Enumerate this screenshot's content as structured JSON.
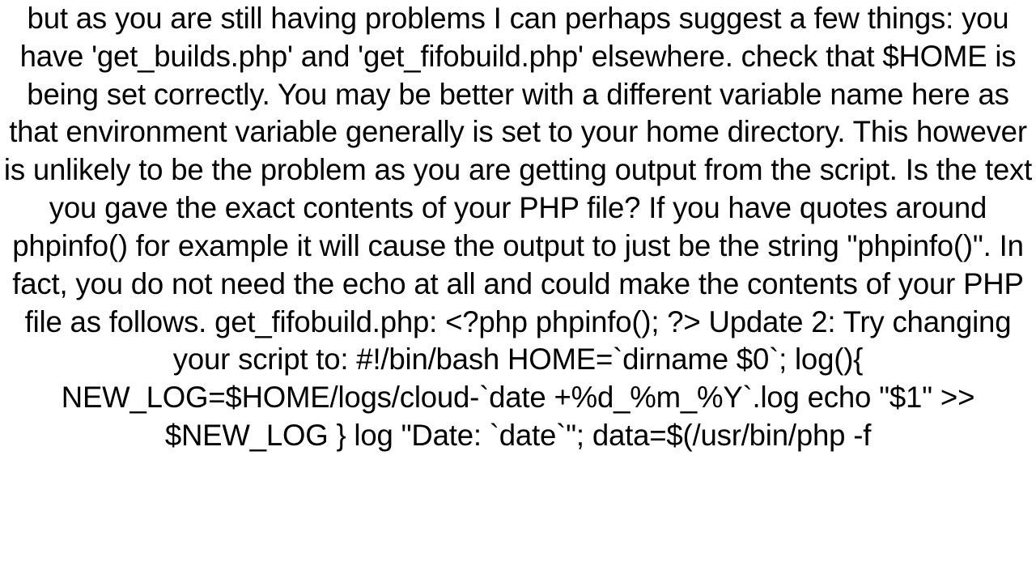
{
  "document": {
    "body_text": "but as you are still having problems I can perhaps suggest a few things:  you have 'get_builds.php' and 'get_fifobuild.php' elsewhere.  check that $HOME is being set correctly. You may be better with a different variable name here as that environment variable generally is set to your home directory. This however is unlikely to be the problem as you are getting output from the script. Is the text you gave the exact contents of your PHP file? If you have quotes around phpinfo() for example it will cause the output to just be the string \"phpinfo()\". In fact, you do not need the echo at all and could make the contents of your PHP file as follows.  get_fifobuild.php: <?php phpinfo(); ?>  Update 2: Try changing your script to:  #!/bin/bash HOME=`dirname $0`; log(){     NEW_LOG=$HOME/logs/cloud-`date +%d_%m_%Y`.log     echo \"$1\" >> $NEW_LOG } log \"Date: `date`\"; data=$(/usr/bin/php -f"
  }
}
